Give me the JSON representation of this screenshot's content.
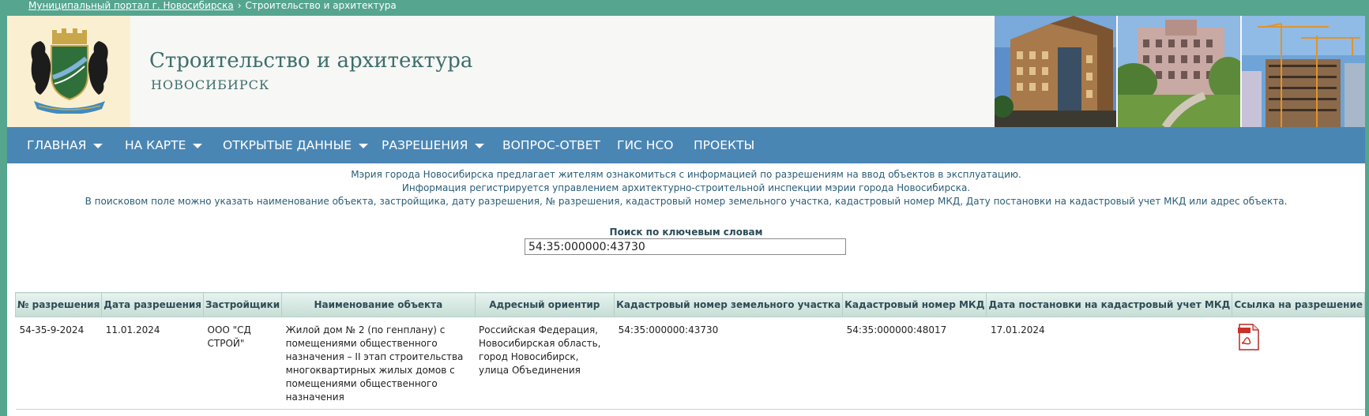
{
  "breadcrumb": {
    "portal": "Муниципальный портал г. Новосибирска",
    "separator": "›",
    "current": "Строительство и архитектура"
  },
  "header": {
    "title": "Строительство и архитектура",
    "subtitle": "НОВОСИБИРСК"
  },
  "nav": {
    "items": [
      {
        "label": "ГЛАВНАЯ"
      },
      {
        "label": "НА КАРТЕ"
      },
      {
        "label": "ОТКРЫТЫЕ ДАННЫЕ"
      },
      {
        "label": "РАЗРЕШЕНИЯ"
      },
      {
        "label": "ВОПРОС-ОТВЕТ"
      },
      {
        "label": "ГИС НСО"
      },
      {
        "label": "ПРОЕКТЫ"
      }
    ]
  },
  "info": {
    "line1": "Мэрия города Новосибирска предлагает жителям ознакомиться с информацией по разрешениям на ввод объектов в эксплуатацию.",
    "line2": "Информация регистрируется управлением архитектурно-строительной инспекции мэрии города Новосибирска.",
    "line3": "В поисковом поле можно указать наименование объекта, застройщика, дату разрешения, № разрешения, кадастровый номер земельного участка, кадастровый номер МКД, Дату постановки на кадастровый учет МКД или адрес объекта."
  },
  "search": {
    "label": "Поиск по ключевым словам",
    "value": "54:35:000000:43730"
  },
  "table": {
    "headers": [
      "№ разрешения",
      "Дата разрешения",
      "Застройщики",
      "Наименование объекта",
      "Адресный ориентир",
      "Кадастровый номер земельного участка",
      "Кадастровый номер МКД",
      "Дата постановки на кадастровый учет МКД",
      "Ссылка на разрешение"
    ],
    "rows": [
      {
        "permit_no": "54-35-9-2024",
        "permit_date": "11.01.2024",
        "developer": "ООО \"СД СТРОЙ\"",
        "object_name": "Жилой дом № 2 (по генплану) с помещениями общественного назначения – II этап строительства многоквартирных жилых домов с помещениями общественного назначения",
        "address": "Российская Федерация, Новосибирская область, город Новосибирск, улица Объединения",
        "land_cadastral": "54:35:000000:43730",
        "mkd_cadastral": "54:35:000000:48017",
        "registration_date": "17.01.2024",
        "link_icon": "pdf-icon"
      }
    ]
  },
  "colors": {
    "topbar": "#55a58f",
    "nav": "#4a86b4",
    "title": "#3d6f6a",
    "info_text": "#2a5d78"
  }
}
